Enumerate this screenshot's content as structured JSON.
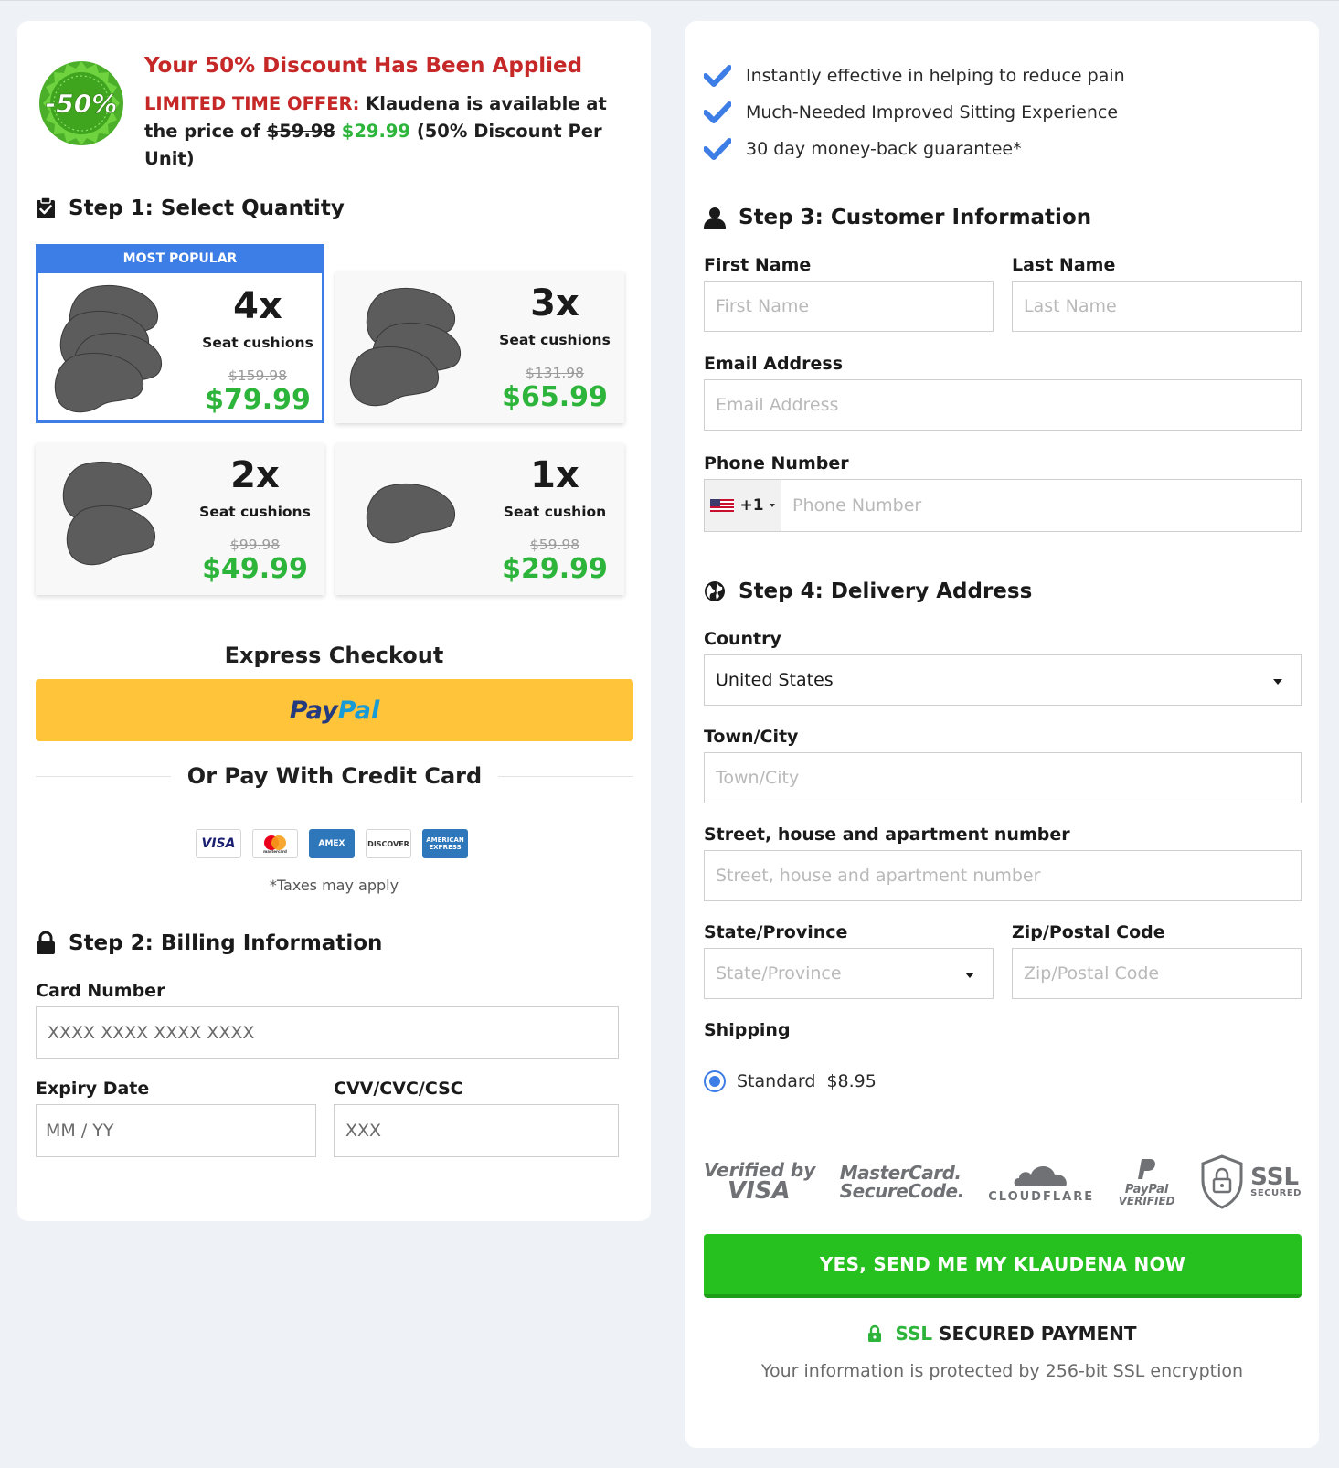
{
  "colors": {
    "accent_blue": "#3d7de6",
    "discount_red": "#c62828",
    "price_green": "#2db43a",
    "paypal_yellow": "#ffc43a",
    "submit_green": "#26c11f"
  },
  "discount": {
    "badge_text": "-50%",
    "title": "Your 50% Discount Has Been Applied",
    "offer_label": "LIMITED TIME OFFER:",
    "offer_text_1": " Klaudena is available at the price of ",
    "old_price": "$59.98",
    "new_price": "$29.99",
    "offer_text_2": " (50% Discount Per Unit)"
  },
  "step1": {
    "title": "Step 1: Select Quantity",
    "popular_label": "MOST POPULAR",
    "options": [
      {
        "qty": "4x",
        "unit": "Seat cushions",
        "old": "$159.98",
        "price": "$79.99",
        "selected": true
      },
      {
        "qty": "3x",
        "unit": "Seat cushions",
        "old": "$131.98",
        "price": "$65.99",
        "selected": false
      },
      {
        "qty": "2x",
        "unit": "Seat cushions",
        "old": "$99.98",
        "price": "$49.99",
        "selected": false
      },
      {
        "qty": "1x",
        "unit": "Seat cushion",
        "old": "$59.98",
        "price": "$29.99",
        "selected": false
      }
    ]
  },
  "express": {
    "title": "Express Checkout",
    "paypal_pay": "Pay",
    "paypal_pal": "Pal",
    "or_text": "Or Pay With Credit Card",
    "cards": [
      "VISA",
      "mastercard",
      "AMEX",
      "DISCOVER",
      "AMERICAN EXPRESS"
    ],
    "taxes_note": "*Taxes may apply"
  },
  "step2": {
    "title": "Step 2: Billing Information",
    "card_number_label": "Card Number",
    "card_number_placeholder": "XXXX XXXX XXXX XXXX",
    "expiry_label": "Expiry Date",
    "expiry_placeholder": "MM / YY",
    "cvv_label": "CVV/CVC/CSC",
    "cvv_placeholder": "XXX"
  },
  "benefits": [
    "Instantly effective in helping to reduce pain",
    "Much-Needed Improved Sitting Experience",
    "30 day money-back guarantee*"
  ],
  "step3": {
    "title": "Step 3: Customer Information",
    "first_name_label": "First Name",
    "first_name_placeholder": "First Name",
    "last_name_label": "Last Name",
    "last_name_placeholder": "Last Name",
    "email_label": "Email Address",
    "email_placeholder": "Email Address",
    "phone_label": "Phone Number",
    "phone_prefix": "+1",
    "phone_placeholder": "Phone Number"
  },
  "step4": {
    "title": "Step 4: Delivery Address",
    "country_label": "Country",
    "country_value": "United States",
    "city_label": "Town/City",
    "city_placeholder": "Town/City",
    "street_label": "Street, house and apartment number",
    "street_placeholder": "Street, house and apartment number",
    "state_label": "State/Province",
    "state_placeholder": "State/Province",
    "zip_label": "Zip/Postal Code",
    "zip_placeholder": "Zip/Postal Code",
    "shipping_label": "Shipping",
    "shipping_option": "Standard",
    "shipping_price": "$8.95"
  },
  "trust": {
    "visa_1": "Verified by",
    "visa_2": "VISA",
    "mc_1": "MasterCard.",
    "mc_2": "SecureCode.",
    "cloudflare": "CLOUDFLARE",
    "paypal_1": "PayPal",
    "paypal_2": "VERIFIED",
    "ssl_1": "SSL",
    "ssl_2": "SECURED"
  },
  "submit_label": "YES, SEND ME MY KLAUDENA NOW",
  "ssl_footer": {
    "ssl": "SSL",
    "rest": " SECURED PAYMENT",
    "note": "Your information is protected by 256-bit SSL encryption"
  }
}
